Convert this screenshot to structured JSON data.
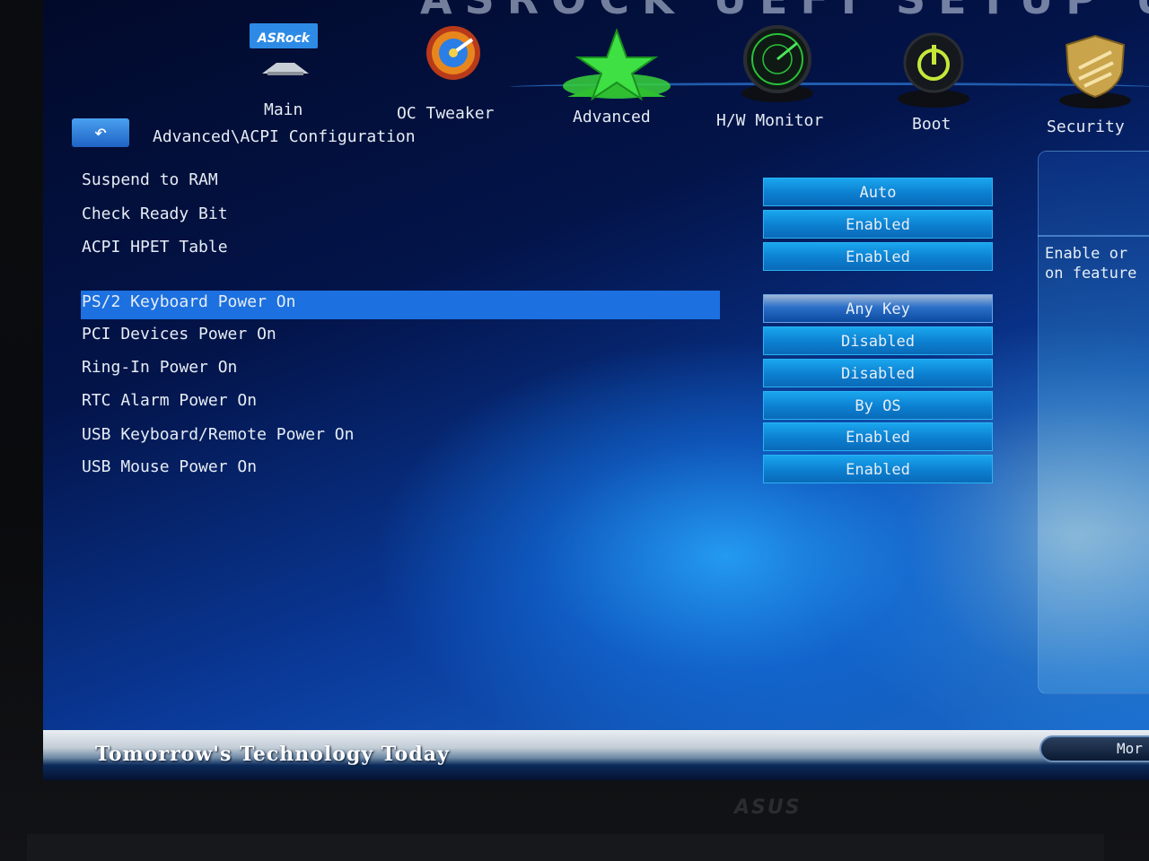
{
  "header": {
    "title": "ASROCK UEFI SETUP UTILITY"
  },
  "nav": {
    "items": [
      {
        "label": "Main",
        "icon": "asrock-logo-icon",
        "logo_text": "ASRock"
      },
      {
        "label": "OC Tweaker",
        "icon": "oc-tweaker-gauge-icon"
      },
      {
        "label": "Advanced",
        "icon": "star-icon",
        "active": true
      },
      {
        "label": "H/W Monitor",
        "icon": "radar-icon"
      },
      {
        "label": "Boot",
        "icon": "power-icon"
      },
      {
        "label": "Security",
        "icon": "shield-icon"
      }
    ]
  },
  "breadcrumb": "Advanced\\ACPI Configuration",
  "back_icon": "back-arrow-icon",
  "options": [
    {
      "label": "Suspend to RAM",
      "value": "Auto"
    },
    {
      "label": "Check Ready Bit",
      "value": "Enabled"
    },
    {
      "label": "ACPI HPET Table",
      "value": "Enabled"
    },
    {
      "label": "PS/2 Keyboard Power On",
      "value": "Any Key",
      "selected": true
    },
    {
      "label": "PCI Devices Power On",
      "value": "Disabled"
    },
    {
      "label": "Ring-In Power On",
      "value": "Disabled"
    },
    {
      "label": "RTC Alarm Power On",
      "value": "By OS"
    },
    {
      "label": "USB Keyboard/Remote Power On",
      "value": "Enabled"
    },
    {
      "label": "USB Mouse Power On",
      "value": "Enabled"
    }
  ],
  "help": {
    "text": "Enable or\non feature"
  },
  "footer": {
    "tagline": "Tomorrow's Technology Today",
    "more_label": "Mor"
  },
  "monitor_brand": "ASUS",
  "colors": {
    "selected_row": "#1c70e0",
    "value_button": "#0c7fd0",
    "background": "#03144a"
  }
}
